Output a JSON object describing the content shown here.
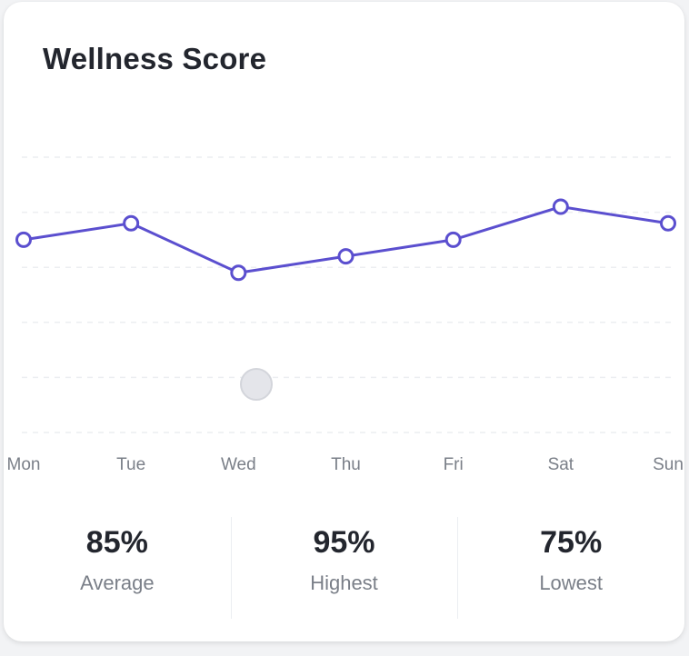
{
  "card": {
    "title": "Wellness Score"
  },
  "chart_data": {
    "type": "line",
    "categories": [
      "Mon",
      "Tue",
      "Wed",
      "Thu",
      "Fri",
      "Sat",
      "Sun"
    ],
    "series": [
      {
        "values": [
          85,
          88,
          79,
          82,
          85,
          91,
          88
        ]
      }
    ],
    "ylim": [
      50,
      100
    ],
    "grid": true,
    "line_color": "#5b4fcf",
    "marker_fill": "#ffffff",
    "hover_indicator_color": "#e2e3e8"
  },
  "stats": [
    {
      "value": "85%",
      "label": "Average"
    },
    {
      "value": "95%",
      "label": "Highest"
    },
    {
      "value": "75%",
      "label": "Lowest"
    }
  ]
}
